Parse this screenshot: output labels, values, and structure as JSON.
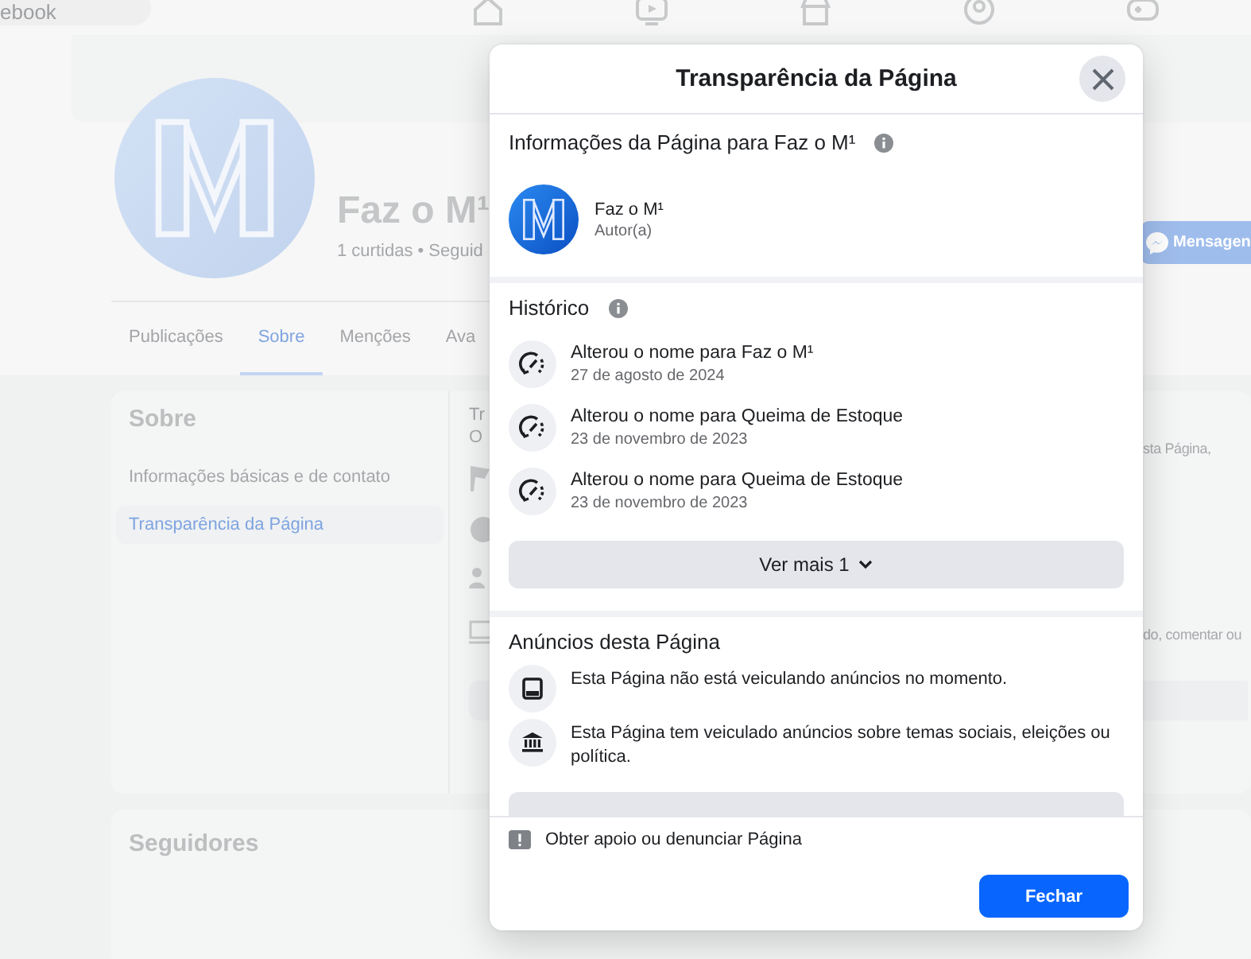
{
  "top_bar": {
    "search_field": {
      "placeholder": "ebook"
    }
  },
  "profile": {
    "name": "Faz o M¹",
    "stats": "1 curtidas • Seguid",
    "message_button": "Mensagen"
  },
  "profile_tabs": [
    {
      "label": "Publicações",
      "selected": false
    },
    {
      "label": "Sobre",
      "selected": true
    },
    {
      "label": "Menções",
      "selected": false
    },
    {
      "label": "Ava",
      "selected": false
    }
  ],
  "about": {
    "title": "Sobre",
    "items": [
      {
        "label": "Informações básicas e de contato",
        "selected": false
      },
      {
        "label": "Transparência da Página",
        "selected": true
      }
    ],
    "main_left": [
      "Tr",
      "O"
    ],
    "main_right": [
      "sta Página,",
      "do, comentar ou"
    ]
  },
  "followers": {
    "title": "Seguidores"
  },
  "dialog": {
    "title": "Transparência da Página",
    "page_info": {
      "heading": "Informações da Página para Faz o M¹",
      "name": "Faz o M¹",
      "role": "Autor(a)"
    },
    "history": {
      "heading": "Histórico",
      "entries": [
        {
          "text": "Alterou o nome para Faz o M¹",
          "date": "27 de agosto de 2024"
        },
        {
          "text": "Alterou o nome para Queima de Estoque",
          "date": "23 de novembro de 2023"
        },
        {
          "text": "Alterou o nome para Queima de Estoque",
          "date": "23 de novembro de 2023"
        }
      ],
      "more_button": "Ver mais 1"
    },
    "ads": {
      "heading": "Anúncios desta Página",
      "items": [
        {
          "kind": "screen",
          "text": "Esta Página não está veiculando anúncios no momento."
        },
        {
          "kind": "bank",
          "text": "Esta Página tem veiculado anúncios sobre temas sociais, eleições ou política."
        }
      ]
    },
    "report_link": "Obter apoio ou denunciar Página",
    "close_button": "Fechar"
  }
}
